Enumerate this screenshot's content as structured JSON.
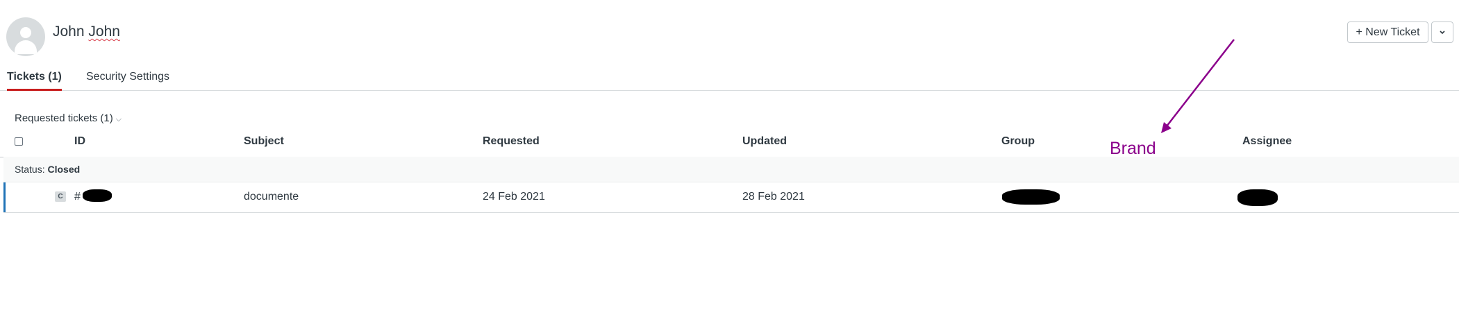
{
  "user": {
    "first": "John",
    "last": "John"
  },
  "header": {
    "new_ticket_label": "+ New Ticket",
    "more_icon": "chevron-down-icon"
  },
  "tabs": [
    {
      "label": "Tickets (1)",
      "active": true
    },
    {
      "label": "Security Settings",
      "active": false
    }
  ],
  "section": {
    "title": "Requested tickets (1)",
    "chevron": "⌵"
  },
  "table": {
    "columns": [
      "ID",
      "Subject",
      "Requested",
      "Updated",
      "Group",
      "Assignee"
    ],
    "group": {
      "prefix": "Status:",
      "value": "Closed"
    },
    "rows": [
      {
        "status_badge": "C",
        "id_prefix": "#",
        "subject": "documente",
        "requested": "24 Feb 2021",
        "updated": "28 Feb 2021"
      }
    ]
  },
  "annotation": {
    "text": "Brand",
    "color": "#8b008b"
  },
  "colors": {
    "tab_underline": "#c81e1e",
    "row_accent": "#1f73b7"
  }
}
